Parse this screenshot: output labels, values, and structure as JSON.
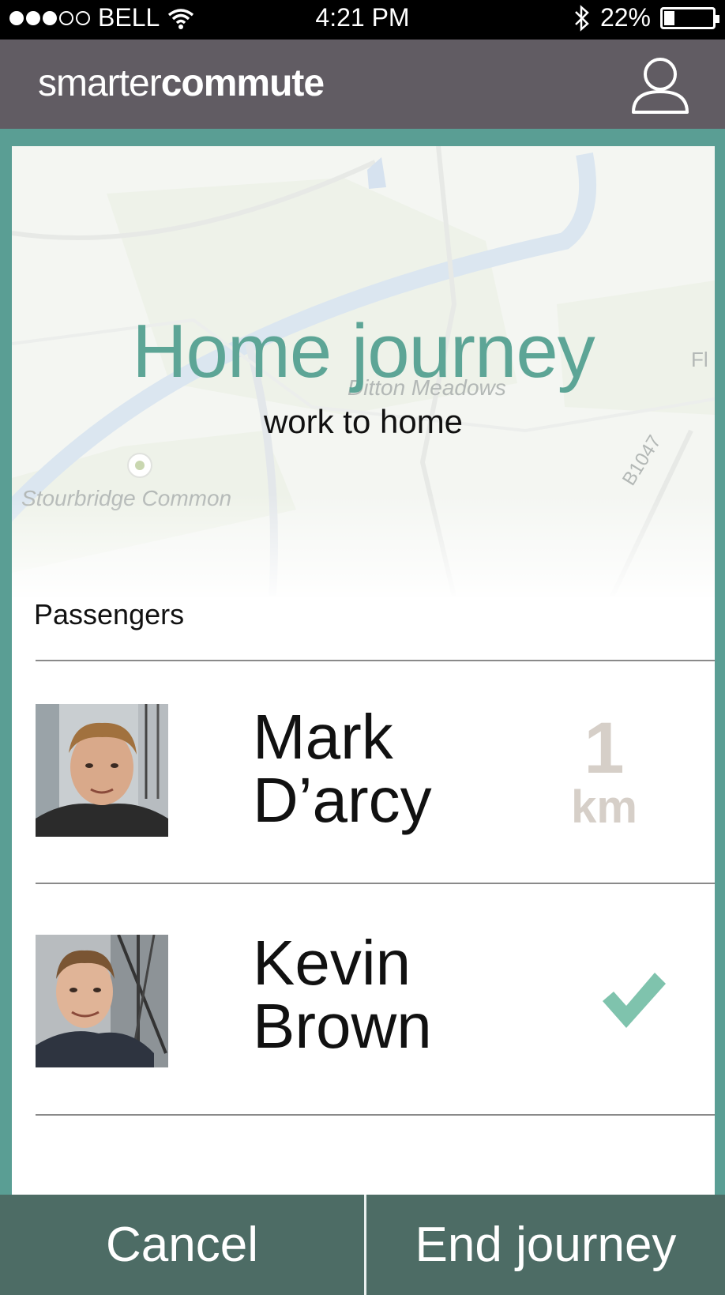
{
  "status_bar": {
    "carrier": "BELL",
    "time": "4:21 PM",
    "battery": "22%",
    "signal_bars_filled": 3,
    "signal_bars_total": 5,
    "battery_level": 0.22
  },
  "app_bar": {
    "logo_light": "smarter",
    "logo_bold": "commute",
    "profile_icon": "user-icon"
  },
  "journey": {
    "title": "Home journey",
    "subtitle": "work to home"
  },
  "map": {
    "labels": [
      "Ditton Meadows",
      "Stourbridge Common",
      "B1047",
      "Fl"
    ]
  },
  "passengers": {
    "heading": "Passengers",
    "items": [
      {
        "first_name": "Mark",
        "last_name": "D’arcy",
        "distance_value": "1",
        "distance_unit": "km",
        "status": "distance"
      },
      {
        "first_name": "Kevin",
        "last_name": "Brown",
        "status": "checked",
        "status_icon": "check-icon"
      }
    ]
  },
  "actions": {
    "cancel_label": "Cancel",
    "end_label": "End journey"
  },
  "colors": {
    "accent": "#5da596",
    "app_bar": "#615c63",
    "frame": "#5a9e94",
    "bottom_bar": "#4d6c65",
    "distance_text": "#d6cfc8"
  }
}
